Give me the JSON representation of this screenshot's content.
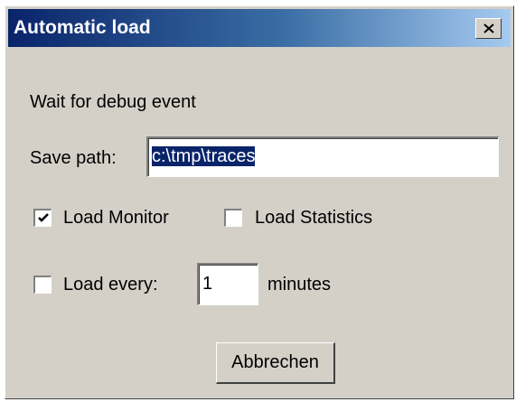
{
  "window": {
    "title": "Automatic load",
    "close_label": "Close"
  },
  "status_text": "Wait for debug event",
  "save_path": {
    "label": "Save path:",
    "value": "c:\\tmp\\traces"
  },
  "options": {
    "load_monitor": {
      "label": "Load Monitor",
      "checked": true
    },
    "load_statistics": {
      "label": "Load Statistics",
      "checked": false
    },
    "load_every": {
      "label": "Load every:",
      "checked": false,
      "value": "1",
      "unit": "minutes"
    }
  },
  "buttons": {
    "cancel": "Abbrechen"
  },
  "colors": {
    "face": "#d4d0c8",
    "title_start": "#0a246a",
    "title_end": "#a6caf0",
    "selection": "#0a246a"
  }
}
